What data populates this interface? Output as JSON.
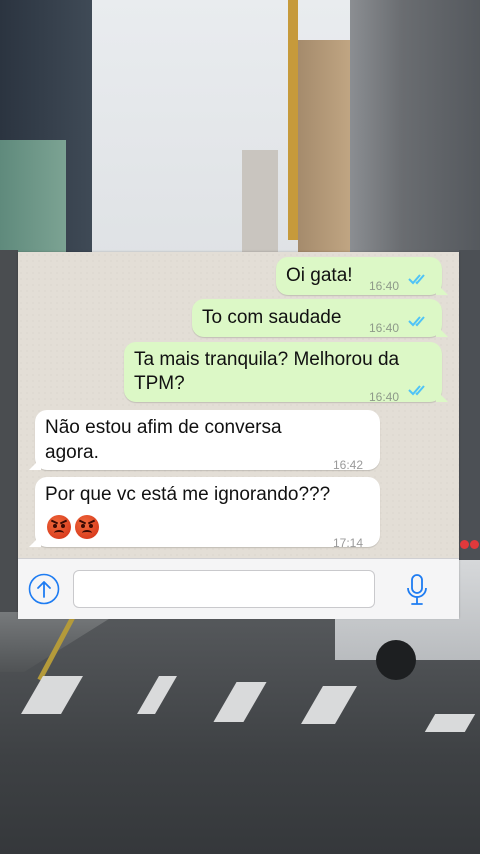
{
  "chat": {
    "messages": [
      {
        "direction": "out",
        "text": "Oi gata!",
        "time": "16:40",
        "status": "read"
      },
      {
        "direction": "out",
        "text": "To com saudade",
        "time": "16:40",
        "status": "read"
      },
      {
        "direction": "out",
        "text_lines": [
          "Ta mais tranquila? Melhorou da",
          "TPM?"
        ],
        "time": "16:40",
        "status": "read"
      },
      {
        "direction": "in",
        "text_lines": [
          "Não estou afim de conversa",
          "agora."
        ],
        "time": "16:42"
      },
      {
        "direction": "in",
        "text": "Por que vc está me ignorando???",
        "emojis": [
          "angry-face-icon",
          "angry-face-icon"
        ],
        "time": "17:14"
      }
    ]
  },
  "input_bar": {
    "message_value": "",
    "icons": {
      "attach": "upload-arrow-icon",
      "voice": "microphone-icon"
    }
  },
  "colors": {
    "outgoing_bubble": "#dcf8c6",
    "incoming_bubble": "#ffffff",
    "chat_background": "#e3ded6",
    "read_ticks": "#4fc3f7",
    "ios_blue": "#1e7cf2"
  }
}
